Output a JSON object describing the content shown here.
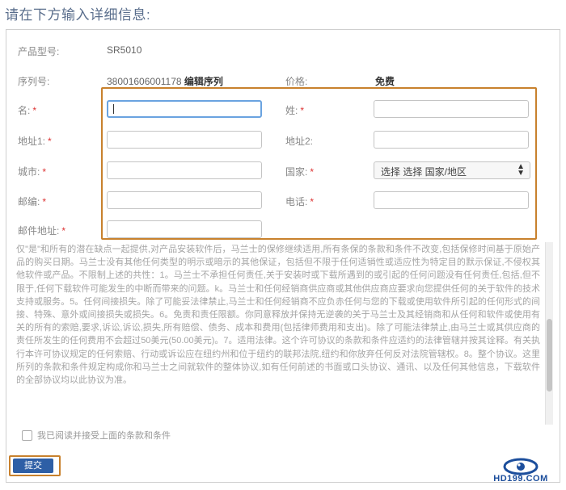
{
  "title": "请在下方输入详细信息:",
  "product": {
    "model_label": "产品型号:",
    "model_value": "SR5010",
    "serial_label": "序列号:",
    "serial_value": "38001606001178",
    "edit_serial_label": "编辑序列",
    "price_label": "价格:",
    "price_value": "免费"
  },
  "form": {
    "required_mark": "*",
    "first_name_label": "名:",
    "last_name_label": "姓:",
    "address1_label": "地址1:",
    "address2_label": "地址2:",
    "city_label": "城市:",
    "country_label": "国家:",
    "country_value": "选择 选择 国家/地区",
    "postcode_label": "邮编:",
    "phone_label": "电话:",
    "email_label": "邮件地址:"
  },
  "terms_text": "仅\"是\"和所有的潜在缺点一起提供,对产品安装软件后，马兰士的保修继续适用,所有条保的条款和条件不改变,包括保修时间基于原始产品的购买日期。马兰士没有其他任何类型的明示或暗示的其他保证，包括但不限于任何适销性或适应性为特定目的默示保证,不侵权其他软件或产品。不限制上述的共性：1。马兰士不承担任何责任,关于安装时或下载所遇到的或引起的任何问题没有任何责任,包括,但不限于,任何下载软件可能发生的中断而带来的问题。k。马兰士和任何经销商供应商或其他供应商应要求向您提供任何的关于软件的技术支持或服务。5。任何间接损失。除了可能妥法律禁止,马兰士和任何经销商不应负赤任何与您的下载或使用软件所引起的任何形式的间接、特殊、意外或间接损失或损失。6。免责和责任限额。你同意释放并保持无逆袭的关于马兰士及其经销商和从任何和软件或使用有关的所有的索赔,要求,诉讼,诉讼,损失,所有赔偿、债务、成本和费用(包括律师费用和支出)。除了可能法律禁止,由马兰士或其供应商的责任所发生的任何费用不会超过50美元(50.00美元)。7。适用法律。这个许可协议的条款和条件应适约的法律管辖并按其诠释。有关执行本许可协议规定的任何索赔、行动或诉讼应在纽约州和位于纽约的联邦法院,纽约和你放弃任何反对法院管辖权。8。整个协议。这里所列的条款和条件规定构成你和马兰士之间就软件的整体协议,如有任何前述的书面或口头协议、通讯、以及任何其他信息，下载软件的全部协议均以此协议为准。",
  "agree_label": "我已阅读并接受上面的条款和条件",
  "submit_label": "提交",
  "logo_text": "HD199.COM",
  "colors": {
    "accent_frame": "#c8812d",
    "submit_button": "#2e5fa6",
    "title_text": "#5b6f8d",
    "logo_blue": "#1c4e9c"
  }
}
